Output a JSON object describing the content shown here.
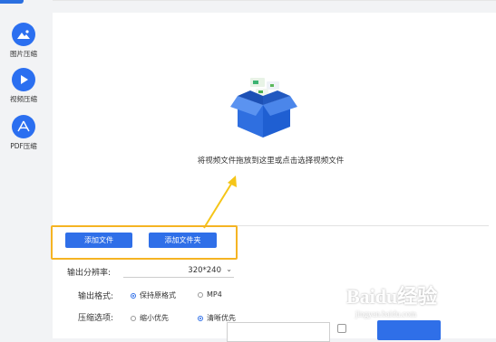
{
  "sidebar": {
    "items": [
      {
        "label": "图片压缩",
        "icon": "image-icon"
      },
      {
        "label": "视频压缩",
        "icon": "play-icon"
      },
      {
        "label": "PDF压缩",
        "icon": "pdf-icon"
      }
    ]
  },
  "dropzone": {
    "hint": "将视频文件拖放到这里或点击选择视频文件",
    "illustration": "open-box-icon"
  },
  "buttons": {
    "add_file": "添加文件",
    "add_folder": "添加文件夹"
  },
  "options": {
    "resolution_label": "输出分辨率:",
    "resolution_value": "320*240",
    "format_label": "输出格式:",
    "format_options": [
      "保持原格式",
      "MP4"
    ],
    "format_selected": "保持原格式",
    "compress_label": "压缩选项:",
    "compress_options": [
      "缩小优先",
      "清晰优先"
    ],
    "compress_selected": "清晰优先"
  },
  "watermark": {
    "brand": "Baidu经验",
    "sub": "jingyan.baidu.com"
  },
  "colors": {
    "accent": "#2f6fe8",
    "highlight": "#f5b423"
  }
}
